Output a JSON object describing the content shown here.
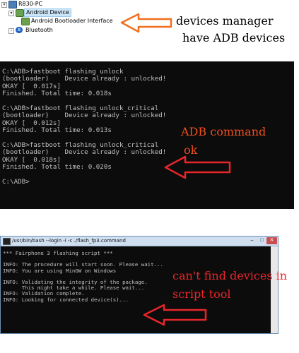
{
  "device_manager": {
    "computer": "R830-PC",
    "category": "Android Device",
    "device": "Android Bootloader Interface",
    "bluetooth": "Bluetooth"
  },
  "annotations": {
    "devices_line1": "devices manager",
    "devices_line2": "have ADB devices",
    "adb_line1": "ADB command",
    "adb_line2": "ok",
    "script_line1": "can't find devices in",
    "script_line2": "script tool",
    "arrow_color_orange": "#f0701e",
    "arrow_color_red": "#e8262a"
  },
  "cmd_console": {
    "lines": [
      "C:\\ADB>fastboot flashing unlock",
      "(bootloader)    Device already : unlocked!",
      "OKAY [  0.017s]",
      "Finished. Total time: 0.018s",
      "",
      "C:\\ADB>fastboot flashing unlock_critical",
      "(bootloader)    Device already : unlocked!",
      "OKAY [  0.012s]",
      "Finished. Total time: 0.013s",
      "",
      "C:\\ADB>fastboot flashing unlock_critical",
      "(bootloader)    Device already : unlocked!",
      "OKAY [  0.018s]",
      "Finished. Total time: 0.020s",
      "",
      "C:\\ADB>"
    ]
  },
  "bash_window": {
    "title": "/usr/bin/bash --login -i -c ./flash_fp3.command",
    "minimize": "–",
    "maximize": "□",
    "close": "✕",
    "lines": [
      "*** Fairphone 3 flashing script ***",
      "",
      "INFO: The procedure will start soon. Please wait...",
      "INFO: You are using MinGW on Windows",
      "",
      "INFO: Validating the integrity of the package.",
      "      This might take a while. Please wait...",
      "INFO: Validation complete.",
      "INFO: Looking for connected device(s)..."
    ]
  }
}
